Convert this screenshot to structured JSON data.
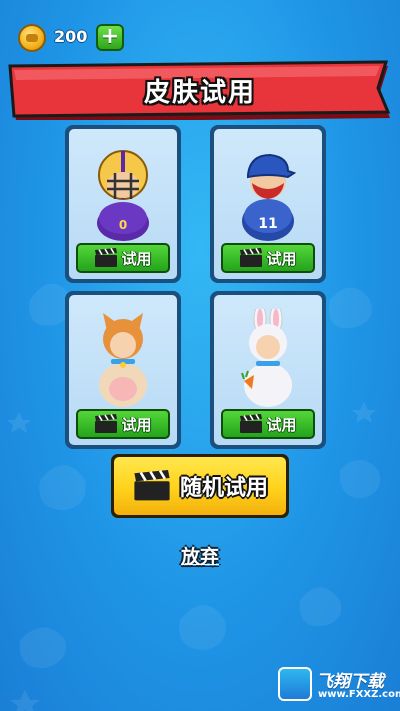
{
  "currency": {
    "amount": "200",
    "add_label": "+"
  },
  "banner": {
    "title": "皮肤试用"
  },
  "skins": [
    {
      "name": "football-player",
      "try_label": "试用"
    },
    {
      "name": "baseball-player",
      "try_label": "试用"
    },
    {
      "name": "cat-costume",
      "try_label": "试用"
    },
    {
      "name": "rabbit-costume",
      "try_label": "试用"
    }
  ],
  "random_button": {
    "label": "随机试用"
  },
  "give_up": {
    "label": "放弃"
  },
  "watermark": {
    "name": "飞翔下载",
    "url": "www.FXXZ.com"
  },
  "colors": {
    "banner_red": "#e8343b",
    "try_green": "#2fb522",
    "random_yellow": "#ffd21a",
    "bg_blue": "#2aa6ee"
  }
}
